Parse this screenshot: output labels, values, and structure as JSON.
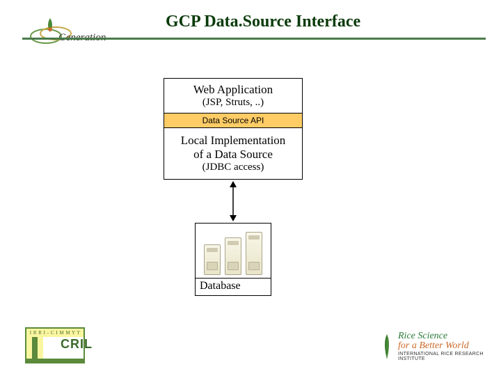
{
  "title": "GCP Data.Source Interface",
  "logos": {
    "generation": {
      "name": "generation-logo",
      "text": "Generation"
    },
    "cril": {
      "top_label": "I R R I - C I M M Y T",
      "text": "CRIL"
    },
    "rice": {
      "line1": "Rice Science",
      "line2": "for a Better World",
      "line3": "INTERNATIONAL RICE RESEARCH INSTITUTE"
    }
  },
  "diagram": {
    "web_app": {
      "line1": "Web Application",
      "line2": "(JSP, Struts, ..)"
    },
    "api_band": "Data Source API",
    "local_impl": {
      "line1": "Local Implementation",
      "line2": "of a Data Source",
      "line3": "(JDBC access)"
    },
    "database": {
      "label": "Database"
    }
  }
}
